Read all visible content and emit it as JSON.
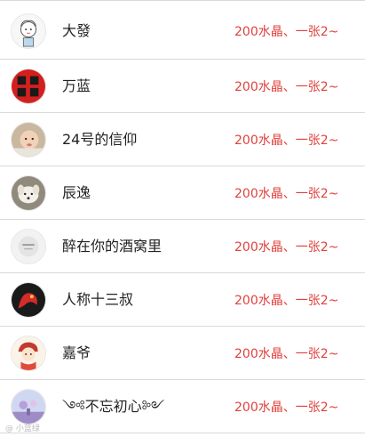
{
  "contacts": [
    {
      "name": "大發",
      "desc": "200水晶、一张2~",
      "avatar": "cartoon-boy-avatar"
    },
    {
      "name": "万蓝",
      "desc": "200水晶、一张2~",
      "avatar": "red-calligraphy-avatar"
    },
    {
      "name": "24号的信仰",
      "desc": "200水晶、一张2~",
      "avatar": "baby-photo-avatar"
    },
    {
      "name": "辰逸",
      "desc": "200水晶、一张2~",
      "avatar": "dog-photo-avatar"
    },
    {
      "name": "醉在你的酒窝里",
      "desc": "200水晶、一张2~",
      "avatar": "grey-device-avatar"
    },
    {
      "name": "人称十三叔",
      "desc": "200水晶、一张2~",
      "avatar": "red-dragon-avatar"
    },
    {
      "name": "嘉爷",
      "desc": "200水晶、一张2~",
      "avatar": "cartoon-girl-avatar"
    },
    {
      "name": "༺不忘初心༻",
      "desc": "200水晶、一张2~",
      "avatar": "purple-scene-avatar"
    }
  ],
  "watermark": "@ 小蓝绿"
}
